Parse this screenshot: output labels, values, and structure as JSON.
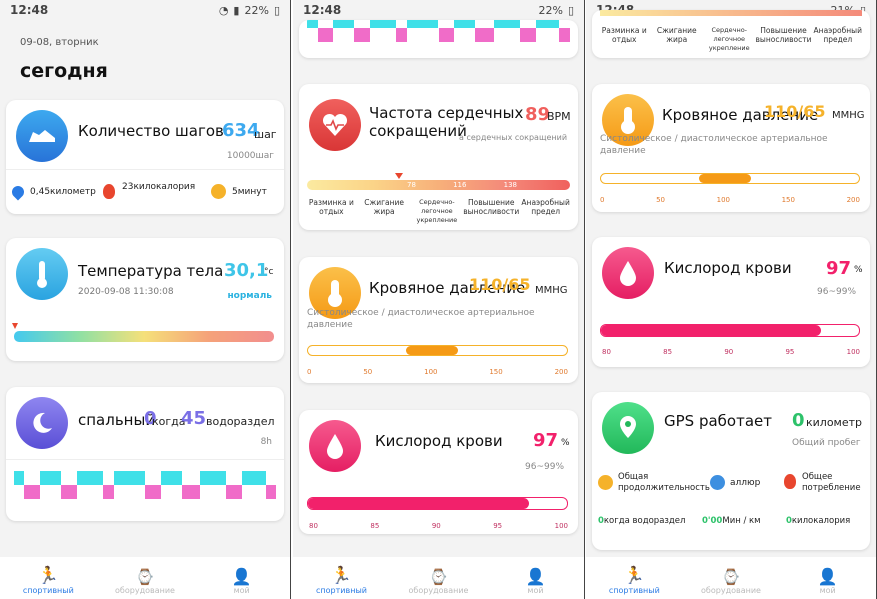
{
  "status": {
    "time": "12:48",
    "battery_left": "22%",
    "battery_mid": "22%",
    "battery_right": "21%"
  },
  "header": {
    "date": "09-08, вторник",
    "title": "сегодня"
  },
  "steps": {
    "title": "Количество шагов",
    "value": "634",
    "unit": "шаг",
    "goal": "10000шаг",
    "distance": "0,45километр",
    "calories": "23килокалория",
    "minutes": "5минут"
  },
  "temperature": {
    "title": "Температура тела",
    "value": "30,1",
    "unit": "°c",
    "timestamp": "2020-09-08 11:30:08",
    "status": "нормаль"
  },
  "sleep": {
    "title": "спальный",
    "value1": "0",
    "mid": "когда",
    "value2": "45",
    "unit": "водораздел",
    "hours": "8h"
  },
  "heart": {
    "title": "Частота сердечных сокращений",
    "value": "89",
    "unit": "BPM",
    "sub": "а сердечных сокращений",
    "ticks": [
      "78",
      "116",
      "138"
    ],
    "zones": [
      "Разминка и отдых",
      "Сжигание жира",
      "Сердечно-легочное укрепление",
      "Повышение выносливости",
      "Анаэробный предел"
    ]
  },
  "pressure": {
    "title": "Кровяное давление",
    "value": "110/65",
    "unit": "MMHG",
    "sub": "Систолическое / диастолическое артериальное давление",
    "ticks": [
      "0",
      "50",
      "100",
      "150",
      "200"
    ]
  },
  "oxygen": {
    "title": "Кислород крови",
    "value": "97",
    "unit": "%",
    "range": "96~99%",
    "level": 0.97,
    "ticks": [
      "80",
      "85",
      "90",
      "95",
      "100"
    ]
  },
  "gps": {
    "title": "GPS работает",
    "value": "0",
    "unit": "километр",
    "sub": "Общий пробег",
    "duration_label": "Общая продолжительность",
    "pace_label": "аллюр",
    "consumption_label": "Общее потребление",
    "duration_value": "0",
    "duration_mid": "когда",
    "duration_unit": "водораздел",
    "pace_value": "0'00",
    "pace_unit": "Мин / км",
    "consumption_value": "0",
    "consumption_unit": "килокалория"
  },
  "tabs": {
    "sport": "спортивный",
    "equipment": "оборудование",
    "me": "мой"
  },
  "colors": {
    "accent": "#2a7be4",
    "heart": "#e94b4b",
    "orange": "#f5a016",
    "pink": "#f2216b",
    "cyan": "#3fe0e8",
    "magenta": "#f06cc8"
  }
}
